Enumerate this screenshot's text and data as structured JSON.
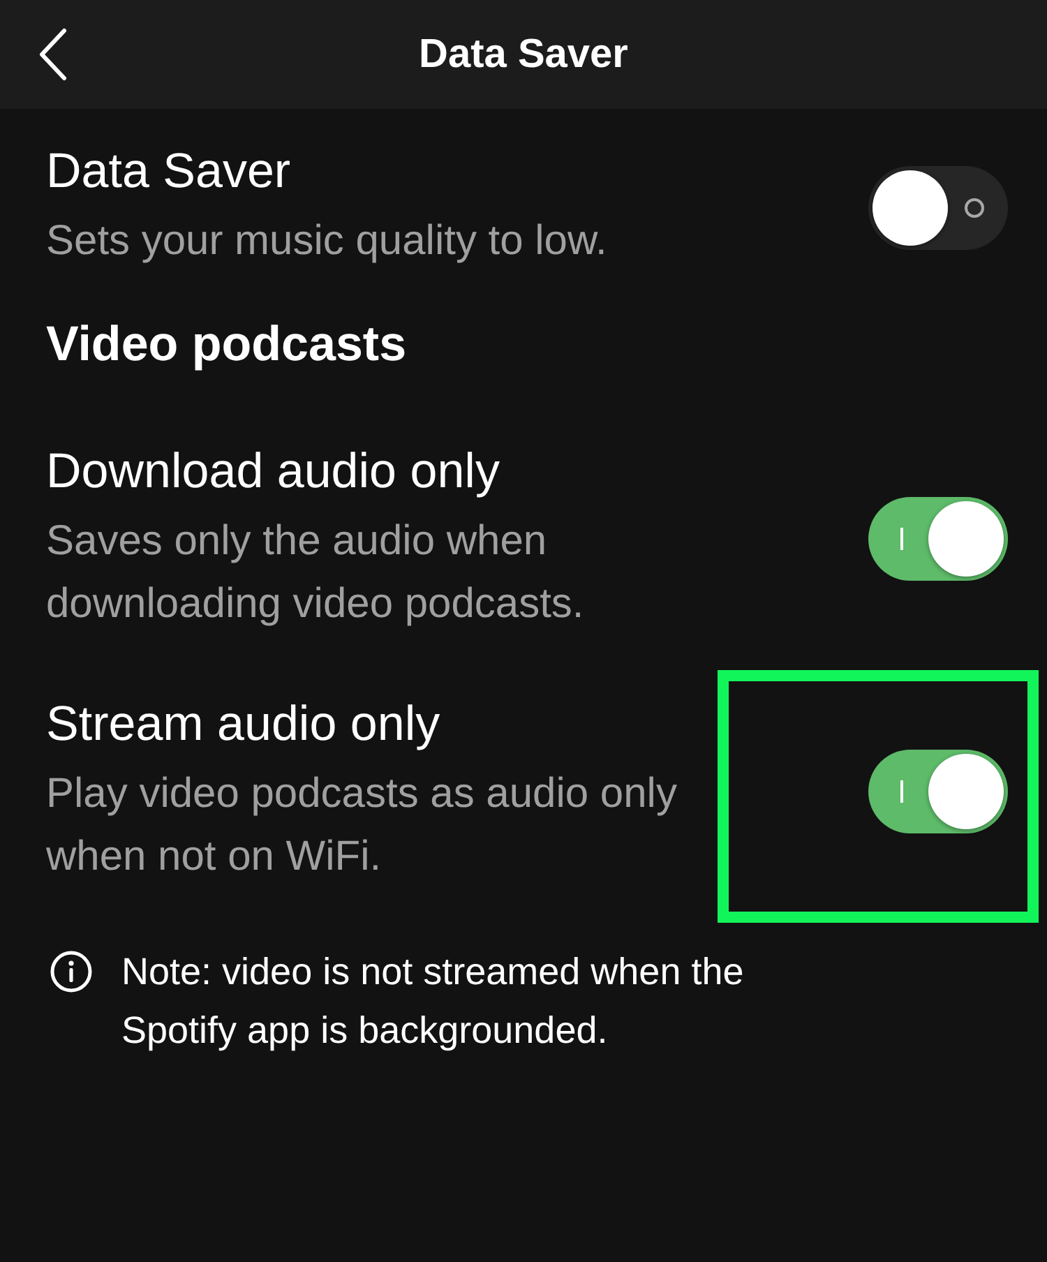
{
  "header": {
    "title": "Data Saver"
  },
  "general_settings": [
    {
      "title": "Data Saver",
      "description": "Sets your music quality to low.",
      "on": false,
      "highlighted": false
    }
  ],
  "video_podcasts": {
    "heading": "Video podcasts",
    "settings": [
      {
        "title": "Download audio only",
        "description": "Saves only the audio when downloading video podcasts.",
        "on": true,
        "highlighted": false
      },
      {
        "title": "Stream audio only",
        "description": "Play video podcasts as audio only when not on WiFi.",
        "on": true,
        "highlighted": true
      }
    ]
  },
  "note": {
    "text": "Note: video is not streamed when the Spotify app is backgrounded."
  }
}
